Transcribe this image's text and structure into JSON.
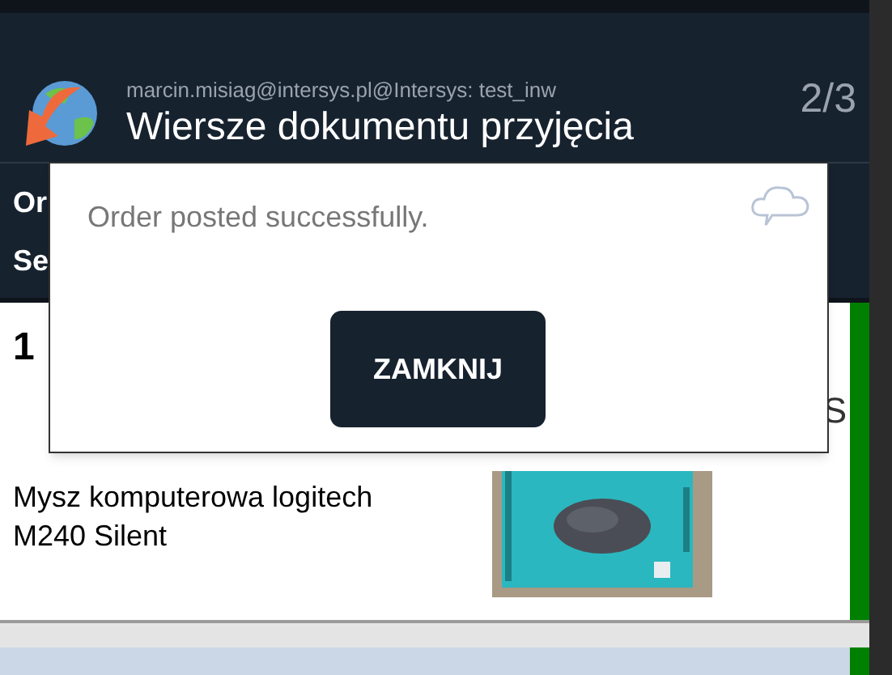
{
  "header": {
    "account": "marcin.misiag@intersys.pl@Intersys: test_inw",
    "title": "Wiersze dokumentu przyjęcia",
    "page": "2/3"
  },
  "info_rows": [
    {
      "label": "Or"
    },
    {
      "label": "Se"
    }
  ],
  "items": [
    {
      "number": "1",
      "side": "S",
      "description": "Mysz komputerowa logitech M240 Silent"
    }
  ],
  "dialog": {
    "message": "Order posted successfully.",
    "button": "ZAMKNIJ"
  }
}
